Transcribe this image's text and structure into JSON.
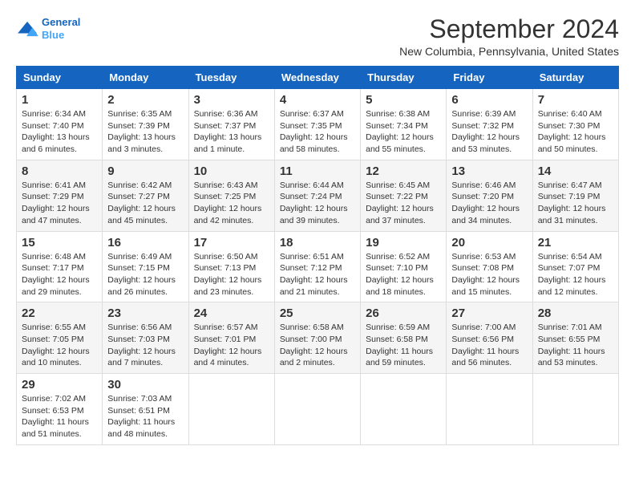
{
  "logo": {
    "line1": "General",
    "line2": "Blue"
  },
  "title": "September 2024",
  "location": "New Columbia, Pennsylvania, United States",
  "days_of_week": [
    "Sunday",
    "Monday",
    "Tuesday",
    "Wednesday",
    "Thursday",
    "Friday",
    "Saturday"
  ],
  "weeks": [
    [
      {
        "day": "1",
        "sunrise": "6:34 AM",
        "sunset": "7:40 PM",
        "daylight": "13 hours and 6 minutes."
      },
      {
        "day": "2",
        "sunrise": "6:35 AM",
        "sunset": "7:39 PM",
        "daylight": "13 hours and 3 minutes."
      },
      {
        "day": "3",
        "sunrise": "6:36 AM",
        "sunset": "7:37 PM",
        "daylight": "13 hours and 1 minute."
      },
      {
        "day": "4",
        "sunrise": "6:37 AM",
        "sunset": "7:35 PM",
        "daylight": "12 hours and 58 minutes."
      },
      {
        "day": "5",
        "sunrise": "6:38 AM",
        "sunset": "7:34 PM",
        "daylight": "12 hours and 55 minutes."
      },
      {
        "day": "6",
        "sunrise": "6:39 AM",
        "sunset": "7:32 PM",
        "daylight": "12 hours and 53 minutes."
      },
      {
        "day": "7",
        "sunrise": "6:40 AM",
        "sunset": "7:30 PM",
        "daylight": "12 hours and 50 minutes."
      }
    ],
    [
      {
        "day": "8",
        "sunrise": "6:41 AM",
        "sunset": "7:29 PM",
        "daylight": "12 hours and 47 minutes."
      },
      {
        "day": "9",
        "sunrise": "6:42 AM",
        "sunset": "7:27 PM",
        "daylight": "12 hours and 45 minutes."
      },
      {
        "day": "10",
        "sunrise": "6:43 AM",
        "sunset": "7:25 PM",
        "daylight": "12 hours and 42 minutes."
      },
      {
        "day": "11",
        "sunrise": "6:44 AM",
        "sunset": "7:24 PM",
        "daylight": "12 hours and 39 minutes."
      },
      {
        "day": "12",
        "sunrise": "6:45 AM",
        "sunset": "7:22 PM",
        "daylight": "12 hours and 37 minutes."
      },
      {
        "day": "13",
        "sunrise": "6:46 AM",
        "sunset": "7:20 PM",
        "daylight": "12 hours and 34 minutes."
      },
      {
        "day": "14",
        "sunrise": "6:47 AM",
        "sunset": "7:19 PM",
        "daylight": "12 hours and 31 minutes."
      }
    ],
    [
      {
        "day": "15",
        "sunrise": "6:48 AM",
        "sunset": "7:17 PM",
        "daylight": "12 hours and 29 minutes."
      },
      {
        "day": "16",
        "sunrise": "6:49 AM",
        "sunset": "7:15 PM",
        "daylight": "12 hours and 26 minutes."
      },
      {
        "day": "17",
        "sunrise": "6:50 AM",
        "sunset": "7:13 PM",
        "daylight": "12 hours and 23 minutes."
      },
      {
        "day": "18",
        "sunrise": "6:51 AM",
        "sunset": "7:12 PM",
        "daylight": "12 hours and 21 minutes."
      },
      {
        "day": "19",
        "sunrise": "6:52 AM",
        "sunset": "7:10 PM",
        "daylight": "12 hours and 18 minutes."
      },
      {
        "day": "20",
        "sunrise": "6:53 AM",
        "sunset": "7:08 PM",
        "daylight": "12 hours and 15 minutes."
      },
      {
        "day": "21",
        "sunrise": "6:54 AM",
        "sunset": "7:07 PM",
        "daylight": "12 hours and 12 minutes."
      }
    ],
    [
      {
        "day": "22",
        "sunrise": "6:55 AM",
        "sunset": "7:05 PM",
        "daylight": "12 hours and 10 minutes."
      },
      {
        "day": "23",
        "sunrise": "6:56 AM",
        "sunset": "7:03 PM",
        "daylight": "12 hours and 7 minutes."
      },
      {
        "day": "24",
        "sunrise": "6:57 AM",
        "sunset": "7:01 PM",
        "daylight": "12 hours and 4 minutes."
      },
      {
        "day": "25",
        "sunrise": "6:58 AM",
        "sunset": "7:00 PM",
        "daylight": "12 hours and 2 minutes."
      },
      {
        "day": "26",
        "sunrise": "6:59 AM",
        "sunset": "6:58 PM",
        "daylight": "11 hours and 59 minutes."
      },
      {
        "day": "27",
        "sunrise": "7:00 AM",
        "sunset": "6:56 PM",
        "daylight": "11 hours and 56 minutes."
      },
      {
        "day": "28",
        "sunrise": "7:01 AM",
        "sunset": "6:55 PM",
        "daylight": "11 hours and 53 minutes."
      }
    ],
    [
      {
        "day": "29",
        "sunrise": "7:02 AM",
        "sunset": "6:53 PM",
        "daylight": "11 hours and 51 minutes."
      },
      {
        "day": "30",
        "sunrise": "7:03 AM",
        "sunset": "6:51 PM",
        "daylight": "11 hours and 48 minutes."
      },
      null,
      null,
      null,
      null,
      null
    ]
  ],
  "labels": {
    "sunrise": "Sunrise:",
    "sunset": "Sunset:",
    "daylight": "Daylight:"
  }
}
